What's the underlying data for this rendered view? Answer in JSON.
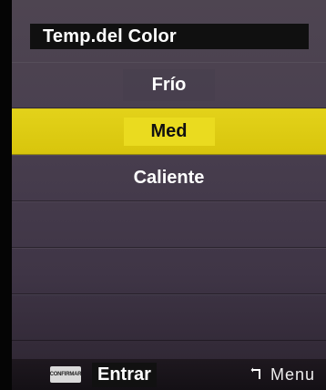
{
  "menu": {
    "title": "Temp.del Color",
    "options": [
      {
        "label": "Frío",
        "selected": false
      },
      {
        "label": "Med",
        "selected": true
      },
      {
        "label": "Caliente",
        "selected": false
      }
    ]
  },
  "footer": {
    "confirm_key_label": "CONFIRMAR",
    "enter_label": "Entrar",
    "menu_label": "Menu",
    "back_icon": "return-arrow-icon"
  },
  "colors": {
    "selected_highlight": "#e3d21a",
    "panel_background": "#4a4050"
  }
}
